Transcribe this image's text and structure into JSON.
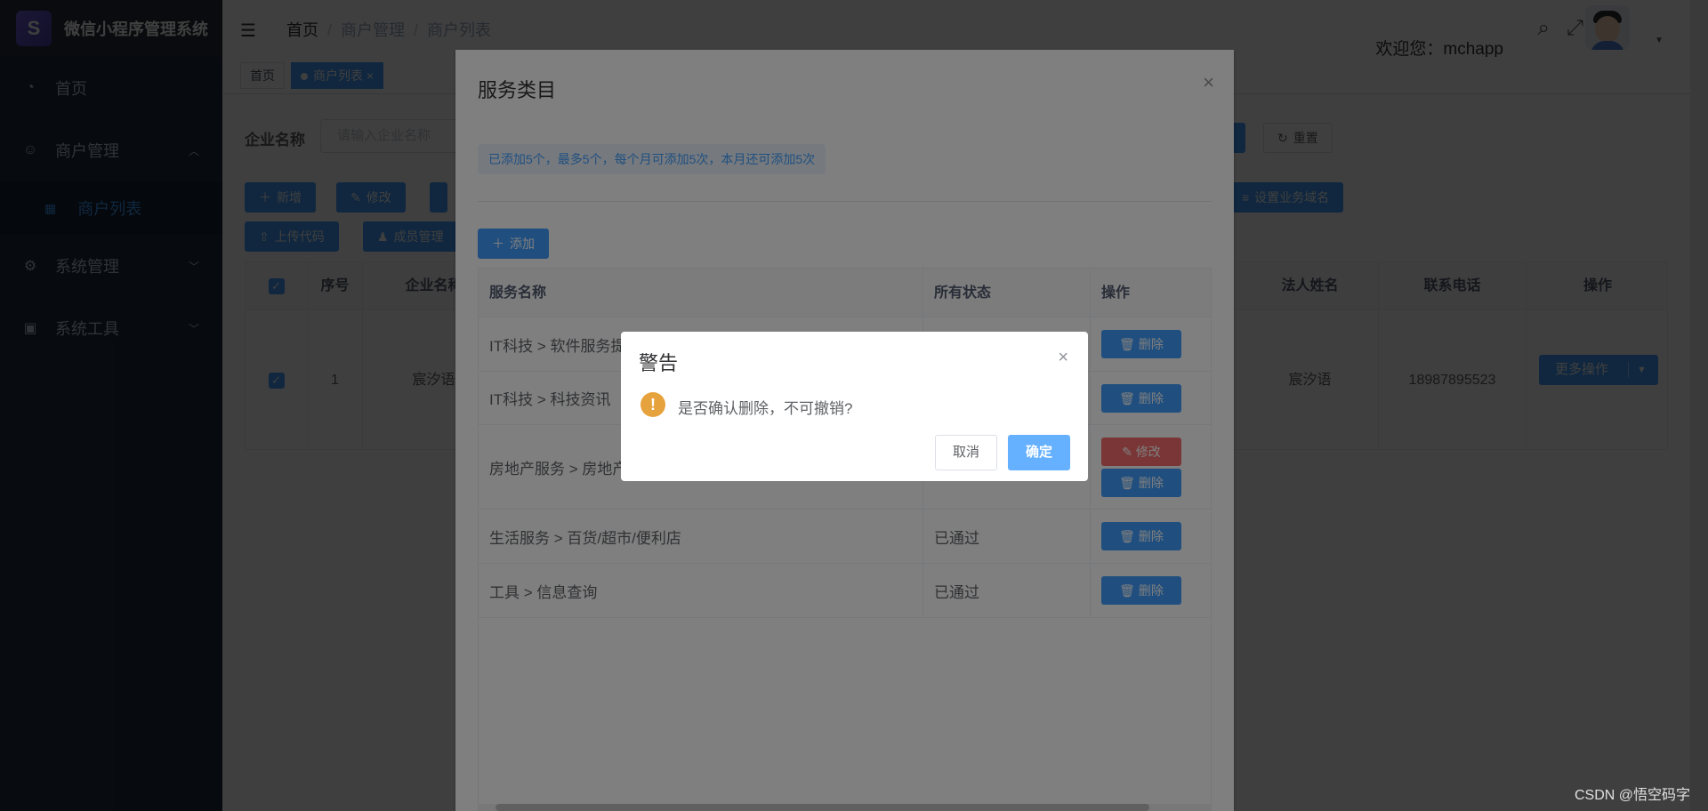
{
  "app": {
    "title": "微信小程序管理系统",
    "logo_icon": "mini-program-logo"
  },
  "sidebar": {
    "items": [
      {
        "label": "首页",
        "icon": "dashboard-icon"
      },
      {
        "label": "商户管理",
        "icon": "merchant-icon",
        "expanded": true
      },
      {
        "label": "商户列表",
        "icon": "table-icon",
        "active": true
      },
      {
        "label": "系统管理",
        "icon": "gear-icon"
      },
      {
        "label": "系统工具",
        "icon": "toolbox-icon"
      }
    ]
  },
  "header": {
    "breadcrumb": [
      "首页",
      "商户管理",
      "商户列表"
    ],
    "welcome": "欢迎您：mchapp"
  },
  "tags": [
    {
      "label": "首页"
    },
    {
      "label": "商户列表",
      "active": true
    }
  ],
  "main": {
    "search_label": "企业名称",
    "search_placeholder": "请输入企业名称",
    "buttons": {
      "add": "新增",
      "edit": "修改",
      "reset": "重置",
      "upload": "上传代码",
      "members": "成员管理",
      "domain": "设置业务域名"
    },
    "table": {
      "headers": {
        "index": "序号",
        "company": "企业名称",
        "legal": "法人姓名",
        "phone": "联系电话",
        "action": "操作"
      },
      "rows": [
        {
          "index": "1",
          "company": "宸汐语",
          "legal": "宸汐语",
          "phone": "18987895523",
          "action": "更多操作"
        }
      ]
    }
  },
  "service_dialog": {
    "title": "服务类目",
    "tip": "已添加5个，最多5个，每个月可添加5次，本月还可添加5次",
    "add_button": "添加",
    "headers": {
      "name": "服务名称",
      "status": "所有状态",
      "action": "操作"
    },
    "rows": [
      {
        "name": "IT科技 > 软件服务提供商",
        "status": "",
        "actions": [
          "删除"
        ]
      },
      {
        "name": "IT科技 > 科技资讯",
        "status": "",
        "actions": [
          "删除"
        ]
      },
      {
        "name": "房地产服务 > 房地产",
        "status": "",
        "actions": [
          "修改",
          "删除"
        ]
      },
      {
        "name": "生活服务 > 百货/超市/便利店",
        "status": "已通过",
        "actions": [
          "删除"
        ]
      },
      {
        "name": "工具 > 信息查询",
        "status": "已通过",
        "actions": [
          "删除"
        ]
      }
    ]
  },
  "warning_dialog": {
    "title": "警告",
    "message": "是否确认删除，不可撤销?",
    "cancel": "取消",
    "confirm": "确定",
    "icon": "warning-icon"
  },
  "watermark": "CSDN @悟空码字",
  "colors": {
    "primary": "#409eff",
    "danger": "#f56c6c",
    "warning": "#e6a23c",
    "sidebar": "#1f2d3d"
  }
}
